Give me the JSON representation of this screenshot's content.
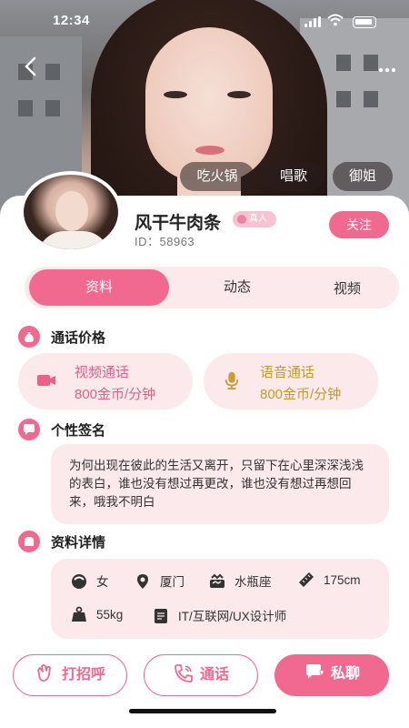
{
  "status_bar": {
    "time": "12:34"
  },
  "colors": {
    "accent": "#f2698f",
    "accent_soft": "#fbe9ec",
    "voice": "#c49a2a"
  },
  "tags": [
    "吃火锅",
    "唱歌",
    "御姐"
  ],
  "profile": {
    "name": "风干牛肉条",
    "real_badge": "真人",
    "id_text": "ID：58963",
    "follow_label": "关注"
  },
  "tabs": [
    {
      "label": "资料",
      "active": true
    },
    {
      "label": "动态",
      "active": false
    },
    {
      "label": "视频",
      "active": false
    }
  ],
  "call_price": {
    "title": "通话价格",
    "video": {
      "label": "视频通话",
      "price": "800金币/分钟",
      "icon": "video-camera-icon"
    },
    "voice": {
      "label": "语音通话",
      "price": "800金币/分钟",
      "icon": "microphone-icon"
    }
  },
  "signature": {
    "title": "个性签名",
    "text": "为何出现在彼此的生活又离开，只留下在心里深深浅浅的表白，谁也没有想过再更改，谁也没有想过再想回来，哦我不明白"
  },
  "details": {
    "title": "资料详情",
    "gender": "女",
    "city": "厦门",
    "zodiac": "水瓶座",
    "height": "175cm",
    "weight": "55kg",
    "job": "IT/互联网/UX设计师"
  },
  "actions": {
    "greet": "打招呼",
    "call": "通话",
    "chat": "私聊"
  }
}
